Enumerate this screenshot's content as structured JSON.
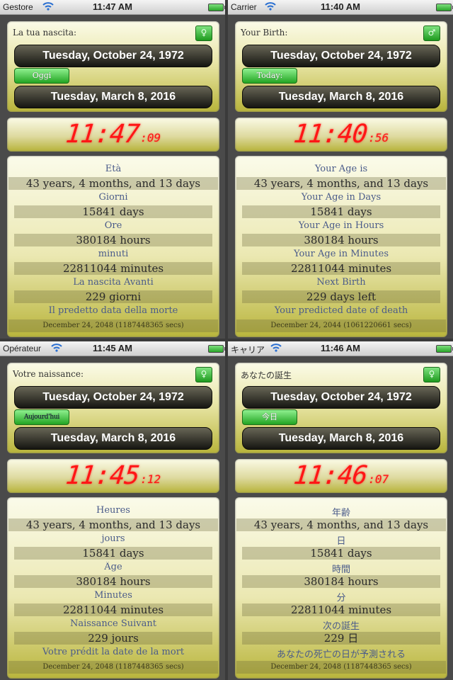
{
  "screens": [
    {
      "status": {
        "carrier": "Gestore",
        "time": "11:47 AM"
      },
      "birth_label": "La tua nascita:",
      "gender_symbol": "♀",
      "birth_date": "Tuesday, October 24, 1972",
      "today_button": "Oggi",
      "today_date": "Tuesday, March 8, 2016",
      "clock": {
        "hm": "11:47",
        "sec": ":09"
      },
      "rows": [
        {
          "label": "Età",
          "value": "43 years, 4 months, and 13 days"
        },
        {
          "label": "Giorni",
          "value": "15841  days"
        },
        {
          "label": "Ore",
          "value": "380184  hours"
        },
        {
          "label": "minuti",
          "value": "22811044  minutes"
        },
        {
          "label": "La nascita Avanti",
          "value": "229 giorni"
        }
      ],
      "death_label": "Il predetto data della morte",
      "death_value": "December 24, 2048 (1187448365 secs)"
    },
    {
      "status": {
        "carrier": "Carrier",
        "time": "11:40 AM"
      },
      "birth_label": "Your Birth:",
      "gender_symbol": "♂",
      "birth_date": "Tuesday, October 24, 1972",
      "today_button": "Today:",
      "today_date": "Tuesday, March 8, 2016",
      "clock": {
        "hm": "11:40",
        "sec": ":56"
      },
      "rows": [
        {
          "label": "Your Age is",
          "value": "43 years, 4 months, and 13 days"
        },
        {
          "label": "Your Age in Days",
          "value": "15841  days"
        },
        {
          "label": "Your Age in Hours",
          "value": "380184  hours"
        },
        {
          "label": "Your Age in Minutes",
          "value": "22811044  minutes"
        },
        {
          "label": "Next Birth",
          "value": "229 days left"
        }
      ],
      "death_label": "Your predicted date of death",
      "death_value": "December 24, 2044 (1061220661 secs)"
    },
    {
      "status": {
        "carrier": "Opérateur",
        "time": "11:45 AM"
      },
      "birth_label": "Votre naissance:",
      "gender_symbol": "♀",
      "birth_date": "Tuesday, October 24, 1972",
      "today_button": "Aujourd'hui",
      "today_date": "Tuesday, March 8, 2016",
      "clock": {
        "hm": "11:45",
        "sec": ":12"
      },
      "rows": [
        {
          "label": "Heures",
          "value": "43 years, 4 months, and 13 days"
        },
        {
          "label": "jours",
          "value": "15841  days"
        },
        {
          "label": "Âge",
          "value": "380184  hours"
        },
        {
          "label": "Minutes",
          "value": "22811044  minutes"
        },
        {
          "label": "Naissance Suivant",
          "value": "229 jours"
        }
      ],
      "death_label": "Votre prédit la date de la mort",
      "death_value": "December 24, 2048 (1187448365 secs)"
    },
    {
      "status": {
        "carrier": "キャリア",
        "time": "11:46 AM"
      },
      "birth_label": "あなたの誕生",
      "gender_symbol": "♀",
      "birth_date": "Tuesday, October 24, 1972",
      "today_button": "今日",
      "today_date": "Tuesday, March 8, 2016",
      "clock": {
        "hm": "11:46",
        "sec": ":07"
      },
      "rows": [
        {
          "label": "年齢",
          "value": "43 years, 4 months, and 13 days"
        },
        {
          "label": "日",
          "value": "15841  days"
        },
        {
          "label": "時間",
          "value": "380184  hours"
        },
        {
          "label": "分",
          "value": "22811044  minutes"
        },
        {
          "label": "次の誕生",
          "value": "229 日"
        }
      ],
      "death_label": "あなたの死亡の日が予測される",
      "death_value": "December 24, 2048 (1187448365 secs)"
    }
  ]
}
